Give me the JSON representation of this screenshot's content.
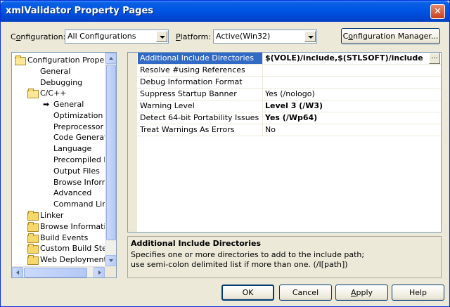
{
  "window": {
    "title": "xmlValidator Property Pages",
    "close_glyph": "✕"
  },
  "config": {
    "config_label_pre": "C",
    "config_label_u": "o",
    "config_label_post": "nfiguration:",
    "config_value": "All Configurations",
    "platform_label_pre": "",
    "platform_label_u": "P",
    "platform_label_post": "latform:",
    "platform_value": "Active(Win32)",
    "manager_pre": "C",
    "manager_u": "o",
    "manager_post": "nfiguration Manager..."
  },
  "tree": {
    "items": [
      {
        "label": "Configuration Properties",
        "icon": "folder-open-icon"
      },
      {
        "label": "General"
      },
      {
        "label": "Debugging"
      },
      {
        "label": "C/C++",
        "icon": "folder-open-icon"
      },
      {
        "label": "General",
        "selected_marker": "pointer-icon"
      },
      {
        "label": "Optimization"
      },
      {
        "label": "Preprocessor"
      },
      {
        "label": "Code Generation"
      },
      {
        "label": "Language"
      },
      {
        "label": "Precompiled Headers"
      },
      {
        "label": "Output Files"
      },
      {
        "label": "Browse Information"
      },
      {
        "label": "Advanced"
      },
      {
        "label": "Command Line"
      },
      {
        "label": "Linker",
        "icon": "folder-icon"
      },
      {
        "label": "Browse Information",
        "icon": "folder-icon"
      },
      {
        "label": "Build Events",
        "icon": "folder-icon"
      },
      {
        "label": "Custom Build Step",
        "icon": "folder-icon"
      },
      {
        "label": "Web Deployment",
        "icon": "folder-icon"
      }
    ]
  },
  "grid": {
    "rows": [
      {
        "name": "Additional Include Directories",
        "value": "$(VOLE)/include,$(STLSOFT)/include",
        "bold": true,
        "selected": true,
        "button": "..."
      },
      {
        "name": "Resolve #using References",
        "value": ""
      },
      {
        "name": "Debug Information Format",
        "value": ""
      },
      {
        "name": "Suppress Startup Banner",
        "value": "Yes (/nologo)"
      },
      {
        "name": "Warning Level",
        "value": "Level 3 (/W3)",
        "bold": true
      },
      {
        "name": "Detect 64-bit Portability Issues",
        "value": "Yes (/Wp64)",
        "bold": true
      },
      {
        "name": "Treat Warnings As Errors",
        "value": "No"
      }
    ]
  },
  "description": {
    "title": "Additional Include Directories",
    "text": "Specifies one or more directories to add to the include path; use semi-colon delimited list if more than one.     (/I[path])"
  },
  "buttons": {
    "ok": "OK",
    "cancel": "Cancel",
    "apply_u": "A",
    "apply_post": "pply",
    "help": "Help"
  },
  "colors": {
    "titlebar": "#0055e5",
    "selection": "#316ac5",
    "dialog_bg": "#ece9d8"
  }
}
